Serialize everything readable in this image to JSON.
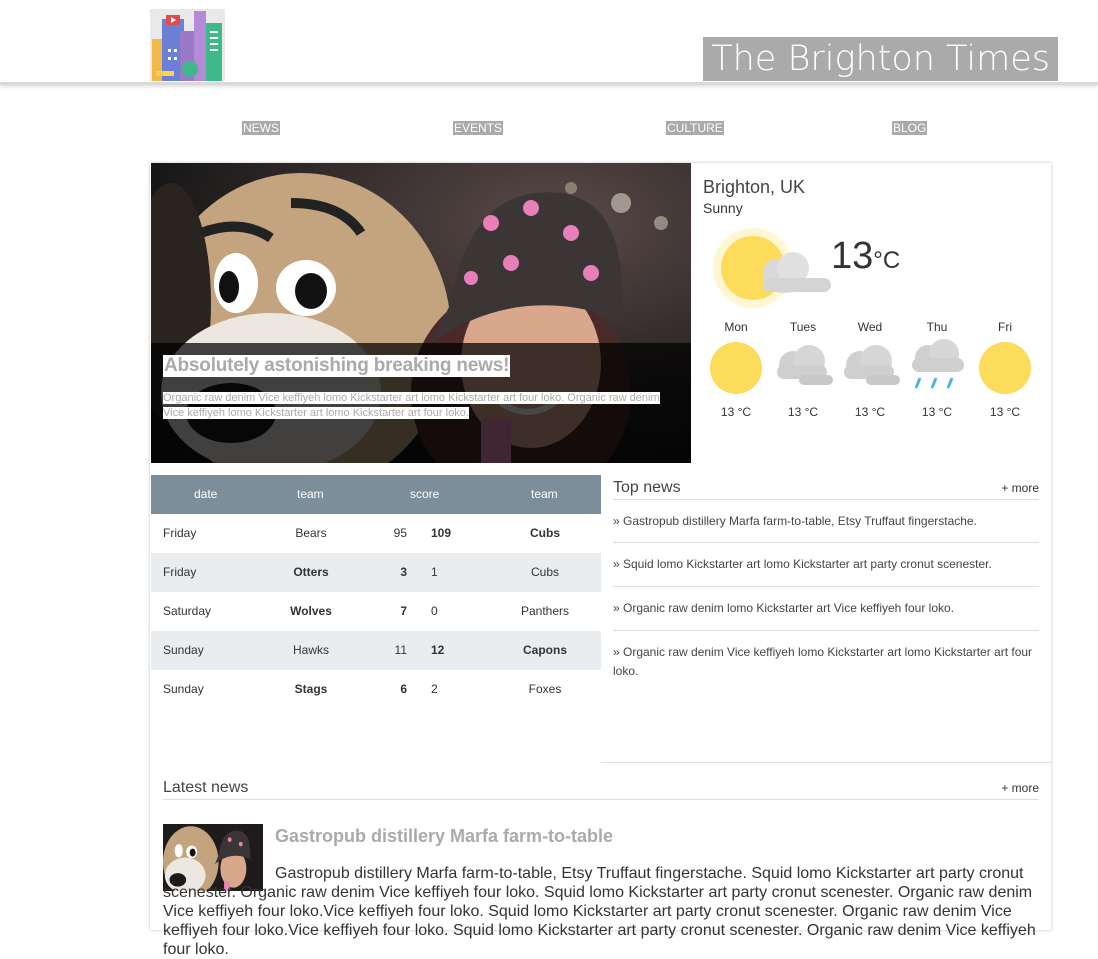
{
  "site": {
    "title": "The Brighton Times"
  },
  "nav": {
    "items": [
      "NEWS",
      "EVENTS",
      "CULTURE",
      "BLOG"
    ]
  },
  "hero": {
    "title": "Absolutely astonishing breaking news!",
    "text": "Organic raw denim Vice keffiyeh lomo Kickstarter art lomo Kickstarter art four loko. Organic raw denim Vice keffiyeh lomo Kickstarter art lomo Kickstarter art four loko."
  },
  "weather": {
    "city": "Brighton, UK",
    "condition": "Sunny",
    "temp": "13",
    "unit": "°C",
    "forecast": [
      {
        "day": "Mon",
        "temp": "13 °C",
        "icon": "sun-icon"
      },
      {
        "day": "Tues",
        "temp": "13 °C",
        "icon": "cloud-icon"
      },
      {
        "day": "Wed",
        "temp": "13 °C",
        "icon": "cloud-icon"
      },
      {
        "day": "Thu",
        "temp": "13 °C",
        "icon": "rain-icon"
      },
      {
        "day": "Fri",
        "temp": "13 °C",
        "icon": "sun-icon"
      }
    ],
    "colors": {
      "sun": "#fddc5c",
      "cloud": "#cccccc",
      "rain": "#4fb7dd"
    }
  },
  "scores": {
    "headers": [
      "date",
      "team",
      "score",
      "team"
    ],
    "rows": [
      {
        "date": "Friday",
        "home": "Bears",
        "home_score": "95",
        "away_score": "109",
        "away": "Cubs",
        "winner": "away"
      },
      {
        "date": "Friday",
        "home": "Otters",
        "home_score": "3",
        "away_score": "1",
        "away": "Cubs",
        "winner": "home"
      },
      {
        "date": "Saturday",
        "home": "Wolves",
        "home_score": "7",
        "away_score": "0",
        "away": "Panthers",
        "winner": "home"
      },
      {
        "date": "Sunday",
        "home": "Hawks",
        "home_score": "11",
        "away_score": "12",
        "away": "Capons",
        "winner": "away"
      },
      {
        "date": "Sunday",
        "home": "Stags",
        "home_score": "6",
        "away_score": "2",
        "away": "Foxes",
        "winner": "home"
      }
    ],
    "header_color": "#7b8e99"
  },
  "top_news": {
    "title": "Top news",
    "more": "+ more",
    "items": [
      "» Gastropub distillery Marfa farm-to-table, Etsy Truffaut fingerstache.",
      "» Squid lomo Kickstarter art lomo Kickstarter art party cronut scenester.",
      "» Organic raw denim lomo Kickstarter art Vice keffiyeh four loko.",
      "» Organic raw denim Vice keffiyeh lomo Kickstarter art lomo Kickstarter art four loko."
    ]
  },
  "latest_news": {
    "title": "Latest news",
    "more": "+ more",
    "article_title": "Gastropub distillery Marfa farm-to-table",
    "article_body": "Gastropub distillery Marfa farm-to-table, Etsy Truffaut fingerstache. Squid lomo Kickstarter art party cronut scenester. Organic raw denim Vice keffiyeh four loko. Squid lomo Kickstarter art party cronut scenester. Organic raw denim Vice keffiyeh four loko.Vice keffiyeh four loko. Squid lomo Kickstarter art party cronut scenester. Organic raw denim Vice keffiyeh four loko.Vice keffiyeh four loko. Squid lomo Kickstarter art party cronut scenester. Organic raw denim Vice keffiyeh four loko."
  }
}
